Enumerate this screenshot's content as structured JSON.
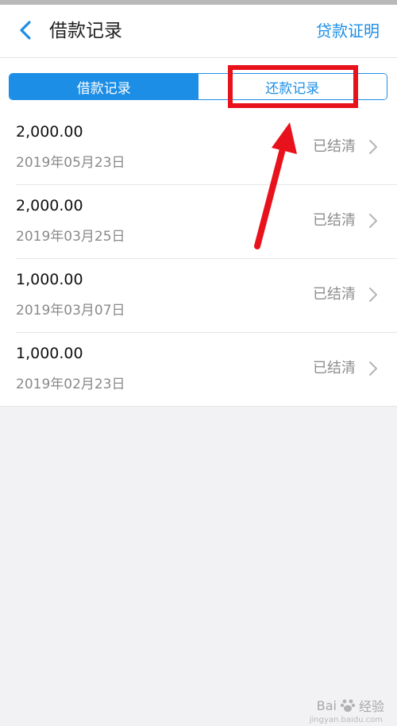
{
  "header": {
    "title": "借款记录",
    "proof_link": "贷款证明"
  },
  "tabs": [
    {
      "label": "借款记录",
      "active": true
    },
    {
      "label": "还款记录",
      "active": false
    }
  ],
  "records": [
    {
      "amount": "2,000.00",
      "date": "2019年05月23日",
      "status": "已结清"
    },
    {
      "amount": "2,000.00",
      "date": "2019年03月25日",
      "status": "已结清"
    },
    {
      "amount": "1,000.00",
      "date": "2019年03月07日",
      "status": "已结清"
    },
    {
      "amount": "1,000.00",
      "date": "2019年02月23日",
      "status": "已结清"
    }
  ],
  "watermark": {
    "brand": "Bai",
    "cn": "经验",
    "url": "jingyan.baidu.com"
  },
  "colors": {
    "accent": "#1d8ee6",
    "annotation": "#e8121d"
  },
  "icons": {
    "back": "chevron-left-icon",
    "row": "chevron-right-icon"
  }
}
